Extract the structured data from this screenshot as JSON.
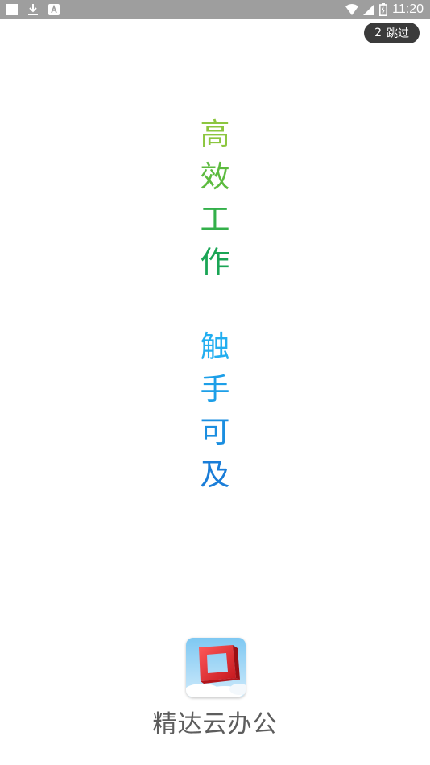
{
  "status_bar": {
    "time": "11:20",
    "left_icons": [
      "square-notification-icon",
      "download-icon",
      "app-notification-icon"
    ],
    "right_icons": [
      "wifi-icon",
      "cell-signal-icon",
      "battery-icon"
    ]
  },
  "skip_button": {
    "countdown": "2",
    "label": "跳过"
  },
  "slogan": {
    "line1": [
      "高",
      "效",
      "工",
      "作"
    ],
    "line2": [
      "触",
      "手",
      "可",
      "及"
    ],
    "colors": {
      "line1": [
        "#8cc63f",
        "#5cbb3f",
        "#33b04a",
        "#1aa555"
      ],
      "line2": [
        "#22aef0",
        "#1d9fe8",
        "#1a8ee0",
        "#1a7dd8"
      ]
    }
  },
  "app": {
    "name": "精达云办公",
    "logo_icon": "square-frame-logo-icon"
  },
  "colors": {
    "status_bar_bg": "#9e9e9e",
    "skip_bg": "#3b3b3b",
    "app_name": "#5d5d5d"
  }
}
